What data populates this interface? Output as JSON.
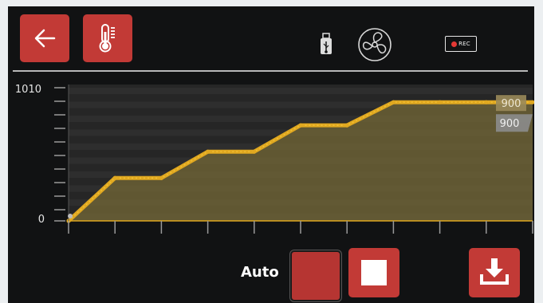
{
  "colors": {
    "accent": "#c23a36",
    "line": "#e0a820",
    "fill": "#6b6035",
    "background": "#111213"
  },
  "toolbar": {
    "back_icon": "arrow-left-icon",
    "temperature_icon": "thermometer-icon",
    "usb_icon": "usb-icon",
    "fan_icon": "fan-icon",
    "rec_label": "REC"
  },
  "chart_data": {
    "type": "line",
    "y_max_label": "1010",
    "y_min_label": "0",
    "ylim": [
      0,
      1010
    ],
    "x_ticks": 10,
    "series": [
      {
        "x": [
          0,
          1,
          2,
          3,
          4,
          5,
          6,
          7,
          8,
          9,
          10
        ],
        "values": [
          0,
          325,
          325,
          525,
          525,
          725,
          725,
          900,
          900,
          900,
          900
        ]
      }
    ],
    "marker_labels": [
      "900",
      "900"
    ]
  },
  "controls": {
    "auto_label": "Auto",
    "auto_button_icon": "auto-square-icon",
    "stop_icon": "stop-icon",
    "download_icon": "download-icon"
  }
}
